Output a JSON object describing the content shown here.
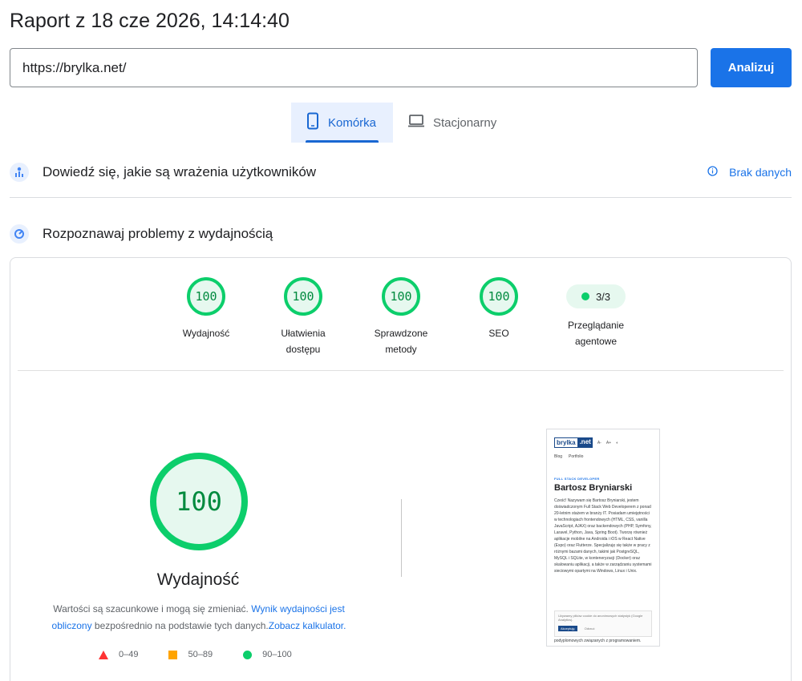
{
  "report_title": "Raport z 18 cze 2026, 14:14:40",
  "url_input": {
    "value": "https://brylka.net/",
    "button": "Analizuj"
  },
  "tabs": {
    "mobile": "Komórka",
    "desktop": "Stacjonarny"
  },
  "field_data": {
    "title": "Dowiedź się, jakie są wrażenia użytkowników",
    "status": "Brak danych"
  },
  "lab_data": {
    "title": "Rozpoznawaj problemy z wydajnością"
  },
  "gauges": [
    {
      "score": "100",
      "label_line1": "Wydajność",
      "label_line2": ""
    },
    {
      "score": "100",
      "label_line1": "Ułatwienia",
      "label_line2": "dostępu"
    },
    {
      "score": "100",
      "label_line1": "Sprawdzone",
      "label_line2": "metody"
    },
    {
      "score": "100",
      "label_line1": "SEO",
      "label_line2": ""
    }
  ],
  "agent": {
    "value": "3/3",
    "label_line1": "Przeglądanie",
    "label_line2": "agentowe"
  },
  "performance": {
    "score": "100",
    "title": "Wydajność",
    "note_text_1": "Wartości są szacunkowe i mogą się zmieniać.",
    "note_link_1": "Wynik wydajności jest obliczony",
    "note_text_2": "bezpośrednio na podstawie tych danych.",
    "note_link_2": "Zobacz kalkulator."
  },
  "legend": {
    "poor": "0–49",
    "average": "50–89",
    "good": "90–100"
  },
  "thumbnail": {
    "logo_1": "brylka",
    "logo_2": ".net",
    "ctrl_1": "A-",
    "ctrl_2": "A+",
    "ctrl_3": "◐",
    "nav_1": "Blog",
    "nav_2": "Portfolio",
    "kicker": "FULL STACK DEVELOPER",
    "name": "Bartosz Bryniarski",
    "body": "Cześć! Nazywam się Bartosz Bryniarski, jestem doświadczonym Full Stack Web Developerem z ponad 20-letnim stażem w branży IT. Posiadam umiejętności w technologiach frontendowych (HTML, CSS, vanilla JavaScript, AJAX) oraz backendowych (PHP, Symfony, Laravel, Python, Java, Spring Boot). Tworzę również aplikacje mobilne na Androida i iOS w React Native (Expo) oraz Flutterze. Specjalizuję się także w pracy z różnymi bazami danych, takimi jak PostgreSQL, MySQL i SQLite, w konteneryzacji (Docker) oraz skalowaniu aplikacji, a także w zarządzaniu systemami sieciowymi opartymi na Windows, Linux i Unix.",
    "cookie_text": "Używamy plików cookie do anonimowych statystyk (Google Analytics).",
    "cookie_accept": "Akceptuję",
    "cookie_reject": "Odrzuć",
    "tail": "podyplomowych związanych z programowaniem."
  },
  "colors": {
    "accent": "#1a73e8",
    "good": "#0cce6b",
    "average": "#ffa400",
    "poor": "#ff3333"
  }
}
